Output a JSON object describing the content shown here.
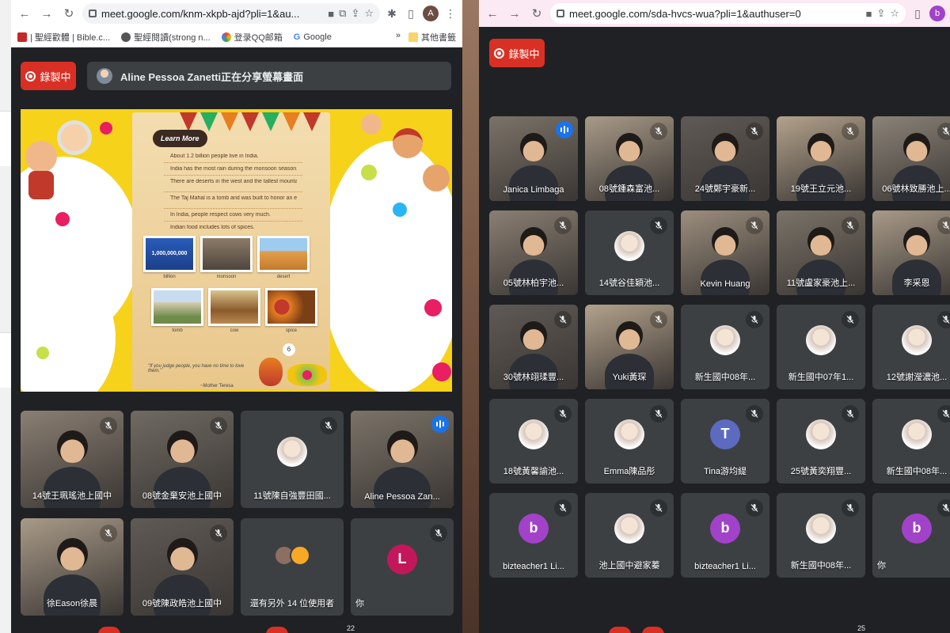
{
  "left_window": {
    "url": "meet.google.com/knm-xkpb-ajd?pli=1&au...",
    "profile_initial": "A",
    "bookmarks": [
      "| 聖經歡體 | Bible.c...",
      "聖經閱讀(strong n...",
      "登录QQ邮箱",
      "Google"
    ],
    "bookmarks_more": "»",
    "other_bookmarks": "其他書籤",
    "recording_label": "錄製中",
    "share_banner": "Aline Pessoa Zanetti正在分享螢幕畫面",
    "slide": {
      "badge": "Learn More",
      "facts": [
        "About 1.2 billion people live in India.",
        "India has the most rain during the monsoon season.",
        "There are deserts in the west and the tallest mountain in the north.",
        "The Taj Mahal is a tomb and was built to honor an emperor's wife.",
        "In India, people respect cows very much.",
        "Indian food includes lots of spices."
      ],
      "photo_captions": [
        "billion",
        "monsoon",
        "desert",
        "tomb",
        "cow",
        "spice"
      ],
      "photo_number": "1,000,000,000",
      "page_number": "6",
      "quote": "\"If you judge people, you have no time to love them.\"",
      "quote_author": "~Mother Teresa"
    },
    "tiles": [
      {
        "name": "14號王珮瑤池上國中",
        "kind": "video"
      },
      {
        "name": "08號金棄安池上國中",
        "kind": "video"
      },
      {
        "name": "11號陳自強豐田國...",
        "kind": "avatar"
      },
      {
        "name": "Aline Pessoa Zan...",
        "kind": "video",
        "speaking": true
      },
      {
        "name": "徐Eason徐晨",
        "kind": "video"
      },
      {
        "name": "09號陳政皓池上國中",
        "kind": "video"
      },
      {
        "name": "還有另外 14 位使用者",
        "kind": "others"
      },
      {
        "name": "你",
        "kind": "letter",
        "letter": "L",
        "color": "#c2185b"
      }
    ],
    "bottom_count": "22"
  },
  "right_window": {
    "url": "meet.google.com/sda-hvcs-wua?pli=1&authuser=0",
    "profile_initial": "b",
    "recording_label": "錄製中",
    "tiles": [
      {
        "name": "Janica Limbaga",
        "kind": "video",
        "speaking": true
      },
      {
        "name": "08號鍾森富池...",
        "kind": "video"
      },
      {
        "name": "24號鄭宇豪新...",
        "kind": "video"
      },
      {
        "name": "19號王立元池...",
        "kind": "video"
      },
      {
        "name": "06號林致勝池上...",
        "kind": "video"
      },
      {
        "name": "05號林柏宇池...",
        "kind": "video"
      },
      {
        "name": "14號谷佳穎池...",
        "kind": "avatar"
      },
      {
        "name": "Kevin Huang",
        "kind": "video"
      },
      {
        "name": "11號盧家豪池上...",
        "kind": "video"
      },
      {
        "name": "李采恩",
        "kind": "video"
      },
      {
        "name": "30號林翊瑈豐...",
        "kind": "video"
      },
      {
        "name": "Yuki黃琛",
        "kind": "video"
      },
      {
        "name": "新生國中08年...",
        "kind": "avatar"
      },
      {
        "name": "新生國中07年1...",
        "kind": "avatar"
      },
      {
        "name": "12號謝瀅濃池...",
        "kind": "avatar"
      },
      {
        "name": "18號黃馨諭池...",
        "kind": "avatar"
      },
      {
        "name": "Emma陳品彤",
        "kind": "avatar"
      },
      {
        "name": "Tina游均緹",
        "kind": "letter",
        "letter": "T",
        "color": "#5c6bc0"
      },
      {
        "name": "25號黃奕翔豐...",
        "kind": "avatar"
      },
      {
        "name": "新生國中08年...",
        "kind": "avatar"
      },
      {
        "name": "bizteacher1 Li...",
        "kind": "letter",
        "letter": "b",
        "color": "#a142c8"
      },
      {
        "name": "池上國中避家蓁",
        "kind": "avatar"
      },
      {
        "name": "bizteacher1 Li...",
        "kind": "letter",
        "letter": "b",
        "color": "#a142c8"
      },
      {
        "name": "新生國中08年...",
        "kind": "avatar"
      },
      {
        "name": "你",
        "kind": "letter",
        "letter": "b",
        "color": "#a142c8"
      }
    ],
    "bottom_count": "25"
  },
  "colors": {
    "meet_bg": "#202124",
    "tile_bg": "#3c4043",
    "record_red": "#d93025",
    "speaking_blue": "#1a73e8",
    "slide_yellow": "#f6d21b"
  }
}
